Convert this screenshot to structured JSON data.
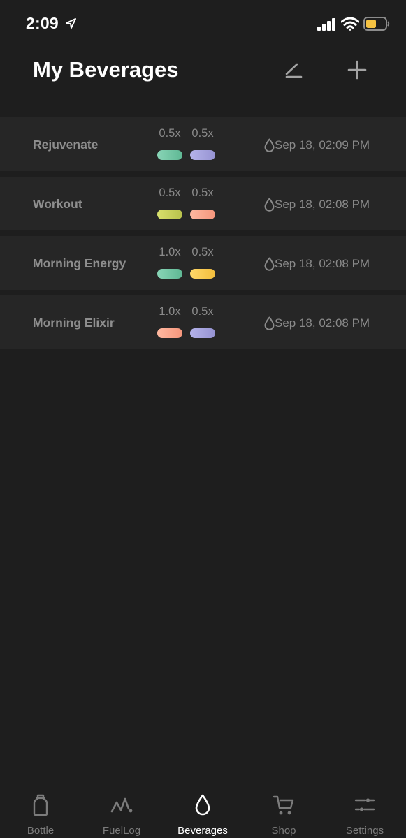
{
  "status_bar": {
    "time": "2:09",
    "battery_color": "#f5c242"
  },
  "header": {
    "title": "My Beverages",
    "edit_icon": "edit-pencil-icon",
    "add_icon": "plus-icon"
  },
  "beverages": [
    {
      "name": "Rejuvenate",
      "doses": [
        "0.5x",
        "0.5x"
      ],
      "pill_colors": [
        [
          "#88d4b6",
          "#5fb894"
        ],
        [
          "#b5b3ea",
          "#9693d2"
        ]
      ],
      "date": "Sep 18, 02:09 PM"
    },
    {
      "name": "Workout",
      "doses": [
        "0.5x",
        "0.5x"
      ],
      "pill_colors": [
        [
          "#d8e06c",
          "#b8c24c"
        ],
        [
          "#ffb8a0",
          "#f5967c"
        ]
      ],
      "date": "Sep 18, 02:08 PM"
    },
    {
      "name": "Morning Energy",
      "doses": [
        "1.0x",
        "0.5x"
      ],
      "pill_colors": [
        [
          "#88d4b6",
          "#5fb894"
        ],
        [
          "#ffd86a",
          "#f2bd3c"
        ]
      ],
      "date": "Sep 18, 02:08 PM"
    },
    {
      "name": "Morning Elixir",
      "doses": [
        "1.0x",
        "0.5x"
      ],
      "pill_colors": [
        [
          "#ffb8a0",
          "#f5967c"
        ],
        [
          "#b5b3ea",
          "#9693d2"
        ]
      ],
      "date": "Sep 18, 02:08 PM"
    }
  ],
  "tabs": [
    {
      "label": "Bottle",
      "icon": "bottle-icon",
      "active": false
    },
    {
      "label": "FuelLog",
      "icon": "fuellog-chart-icon",
      "active": false
    },
    {
      "label": "Beverages",
      "icon": "drop-icon",
      "active": true
    },
    {
      "label": "Shop",
      "icon": "cart-icon",
      "active": false
    },
    {
      "label": "Settings",
      "icon": "sliders-icon",
      "active": false
    }
  ]
}
